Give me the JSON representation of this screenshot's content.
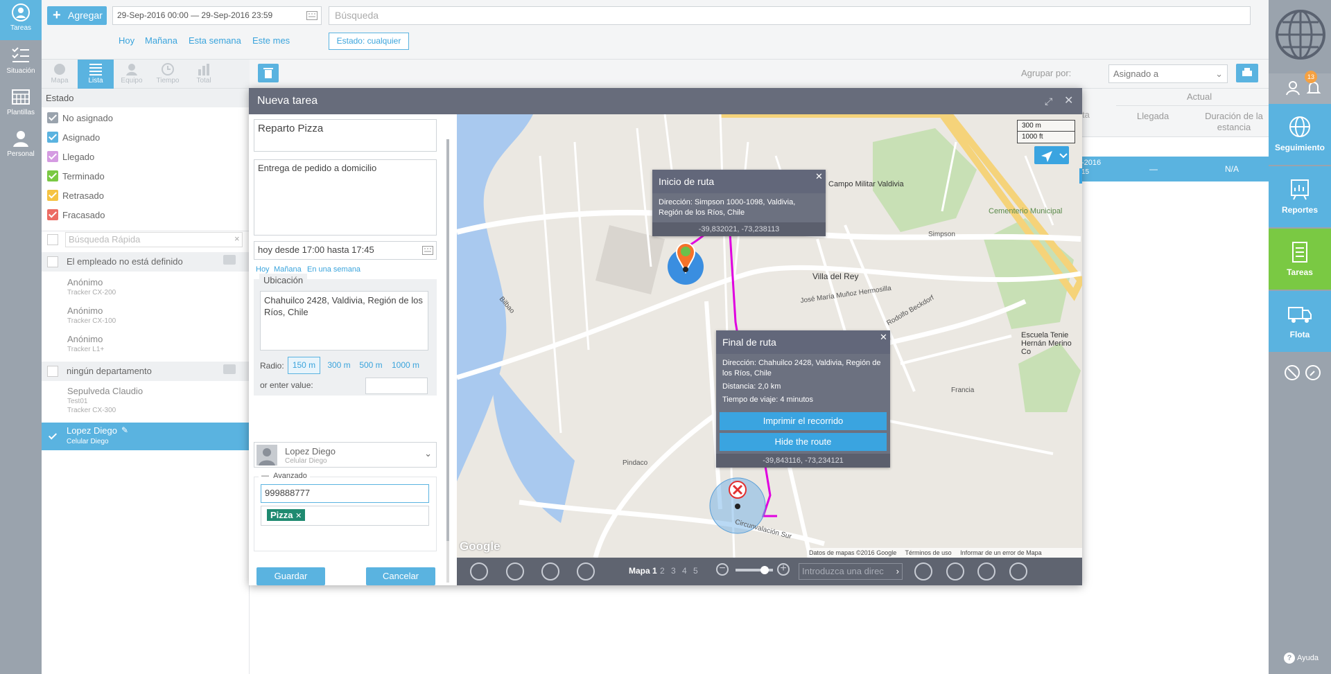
{
  "left_nav": [
    {
      "label": "Tareas",
      "icon": "person-circle-icon"
    },
    {
      "label": "Situación",
      "icon": "checklist-icon"
    },
    {
      "label": "Plantillas",
      "icon": "calendar-grid-icon"
    },
    {
      "label": "Personal",
      "icon": "person-icon"
    }
  ],
  "topbar": {
    "add_label": "Agregar",
    "date_range": "29-Sep-2016 00:00 — 29-Sep-2016 23:59",
    "search_placeholder": "Búsqueda",
    "quick": [
      "Hoy",
      "Mañana",
      "Esta semana",
      "Este mes"
    ],
    "estado": "Estado: cualquier"
  },
  "view_tabs": [
    "Mapa",
    "Lista",
    "Equipo",
    "Tiempo",
    "Total"
  ],
  "status_section": {
    "title": "Estado",
    "items": [
      {
        "label": "No asignado",
        "color": "#9aa3ad"
      },
      {
        "label": "Asignado",
        "color": "#5ab3e0"
      },
      {
        "label": "Llegado",
        "color": "#d59be2"
      },
      {
        "label": "Terminado",
        "color": "#7ac943"
      },
      {
        "label": "Retrasado",
        "color": "#f5c342"
      },
      {
        "label": "Fracasado",
        "color": "#ec6b63"
      }
    ]
  },
  "quick_search_placeholder": "Búsqueda Rápida",
  "groups": [
    {
      "title": "El empleado no está definido",
      "employees": [
        {
          "name": "Anónimo",
          "device": "Tracker CX-200"
        },
        {
          "name": "Anónimo",
          "device": "Tracker CX-100"
        },
        {
          "name": "Anónimo",
          "device": "Tracker L1+"
        }
      ]
    },
    {
      "title": "ningún departamento",
      "employees": [
        {
          "name": "Sepulveda Claudio",
          "device": "Test01",
          "device2": "Tracker CX-300"
        }
      ]
    }
  ],
  "selected_employee": {
    "name": "Lopez Diego",
    "device": "Celular Diego"
  },
  "toolbar": {
    "group_by_label": "Agrupar por:",
    "group_by_value": "Asignado a"
  },
  "table": {
    "actual_header": "Actual",
    "columns": [
      "Llegada",
      "Duración de la estancia"
    ],
    "row": {
      "date": "-2016",
      "arrival": "—",
      "duration": "N/A",
      "sub": "15"
    },
    "cut_header": "ta"
  },
  "right_nav": [
    {
      "label": "Seguimiento"
    },
    {
      "label": "Reportes"
    },
    {
      "label": "Tareas"
    },
    {
      "label": "Flota"
    }
  ],
  "notif_count": "13",
  "help_label": "Ayuda",
  "modal": {
    "title": "Nueva tarea",
    "task_name": "Reparto Pizza",
    "description": "Entrega de pedido a domicilio",
    "time": "hoy desde 17:00 hasta 17:45",
    "time_quick": [
      "Hoy",
      "Mañana",
      "En una semana"
    ],
    "location_label": "Ubicación",
    "location_address": "Chahuilco 2428, Valdivia, Región de los Ríos, Chile",
    "radius_label": "Radio:",
    "radius_options": [
      "150 m",
      "300 m",
      "500 m",
      "1000 m"
    ],
    "enter_value_label": "or enter value:",
    "assignee_name": "Lopez Diego",
    "assignee_device": "Celular Diego",
    "advanced_label": "Avanzado",
    "phone": "999888777",
    "tag": "Pizza",
    "save_label": "Guardar",
    "cancel_label": "Cancelar"
  },
  "map": {
    "start_popup": {
      "title": "Inicio de ruta",
      "address": "Dirección: Simpson 1000-1098, Valdivia, Región de los Ríos, Chile",
      "coords": "-39,832021, -73,238113"
    },
    "end_popup": {
      "title": "Final de ruta",
      "address": "Dirección: Chahuilco 2428, Valdivia, Región de los Ríos, Chile",
      "distance": "Distancia: 2,0 km",
      "time": "Tiempo de viaje: 4 minutos",
      "print_label": "Imprimir el recorrido",
      "hide_label": "Hide the route",
      "coords": "-39,843116, -73,234121"
    },
    "scale_m": "300 m",
    "scale_ft": "1000 ft",
    "attribution": "Datos de mapas ©2016 Google     Términos de uso     Informar de un error de Mapa",
    "google": "Google",
    "labels": [
      "Cementerio Municipal",
      "Villa del Rey",
      "Escuela Tenie Hernán Merino Co",
      "Campo Militar Valdivia",
      "José María Muñoz Hermosilla",
      "Rodolfo Beckdorf",
      "Circunvalación Sur",
      "Pindaco",
      "Bilbao",
      "Simpson",
      "Francia"
    ],
    "map_tabs": [
      "Mapa 1",
      "2",
      "3",
      "4",
      "5"
    ],
    "address_placeholder": "Introduzca una direc"
  }
}
